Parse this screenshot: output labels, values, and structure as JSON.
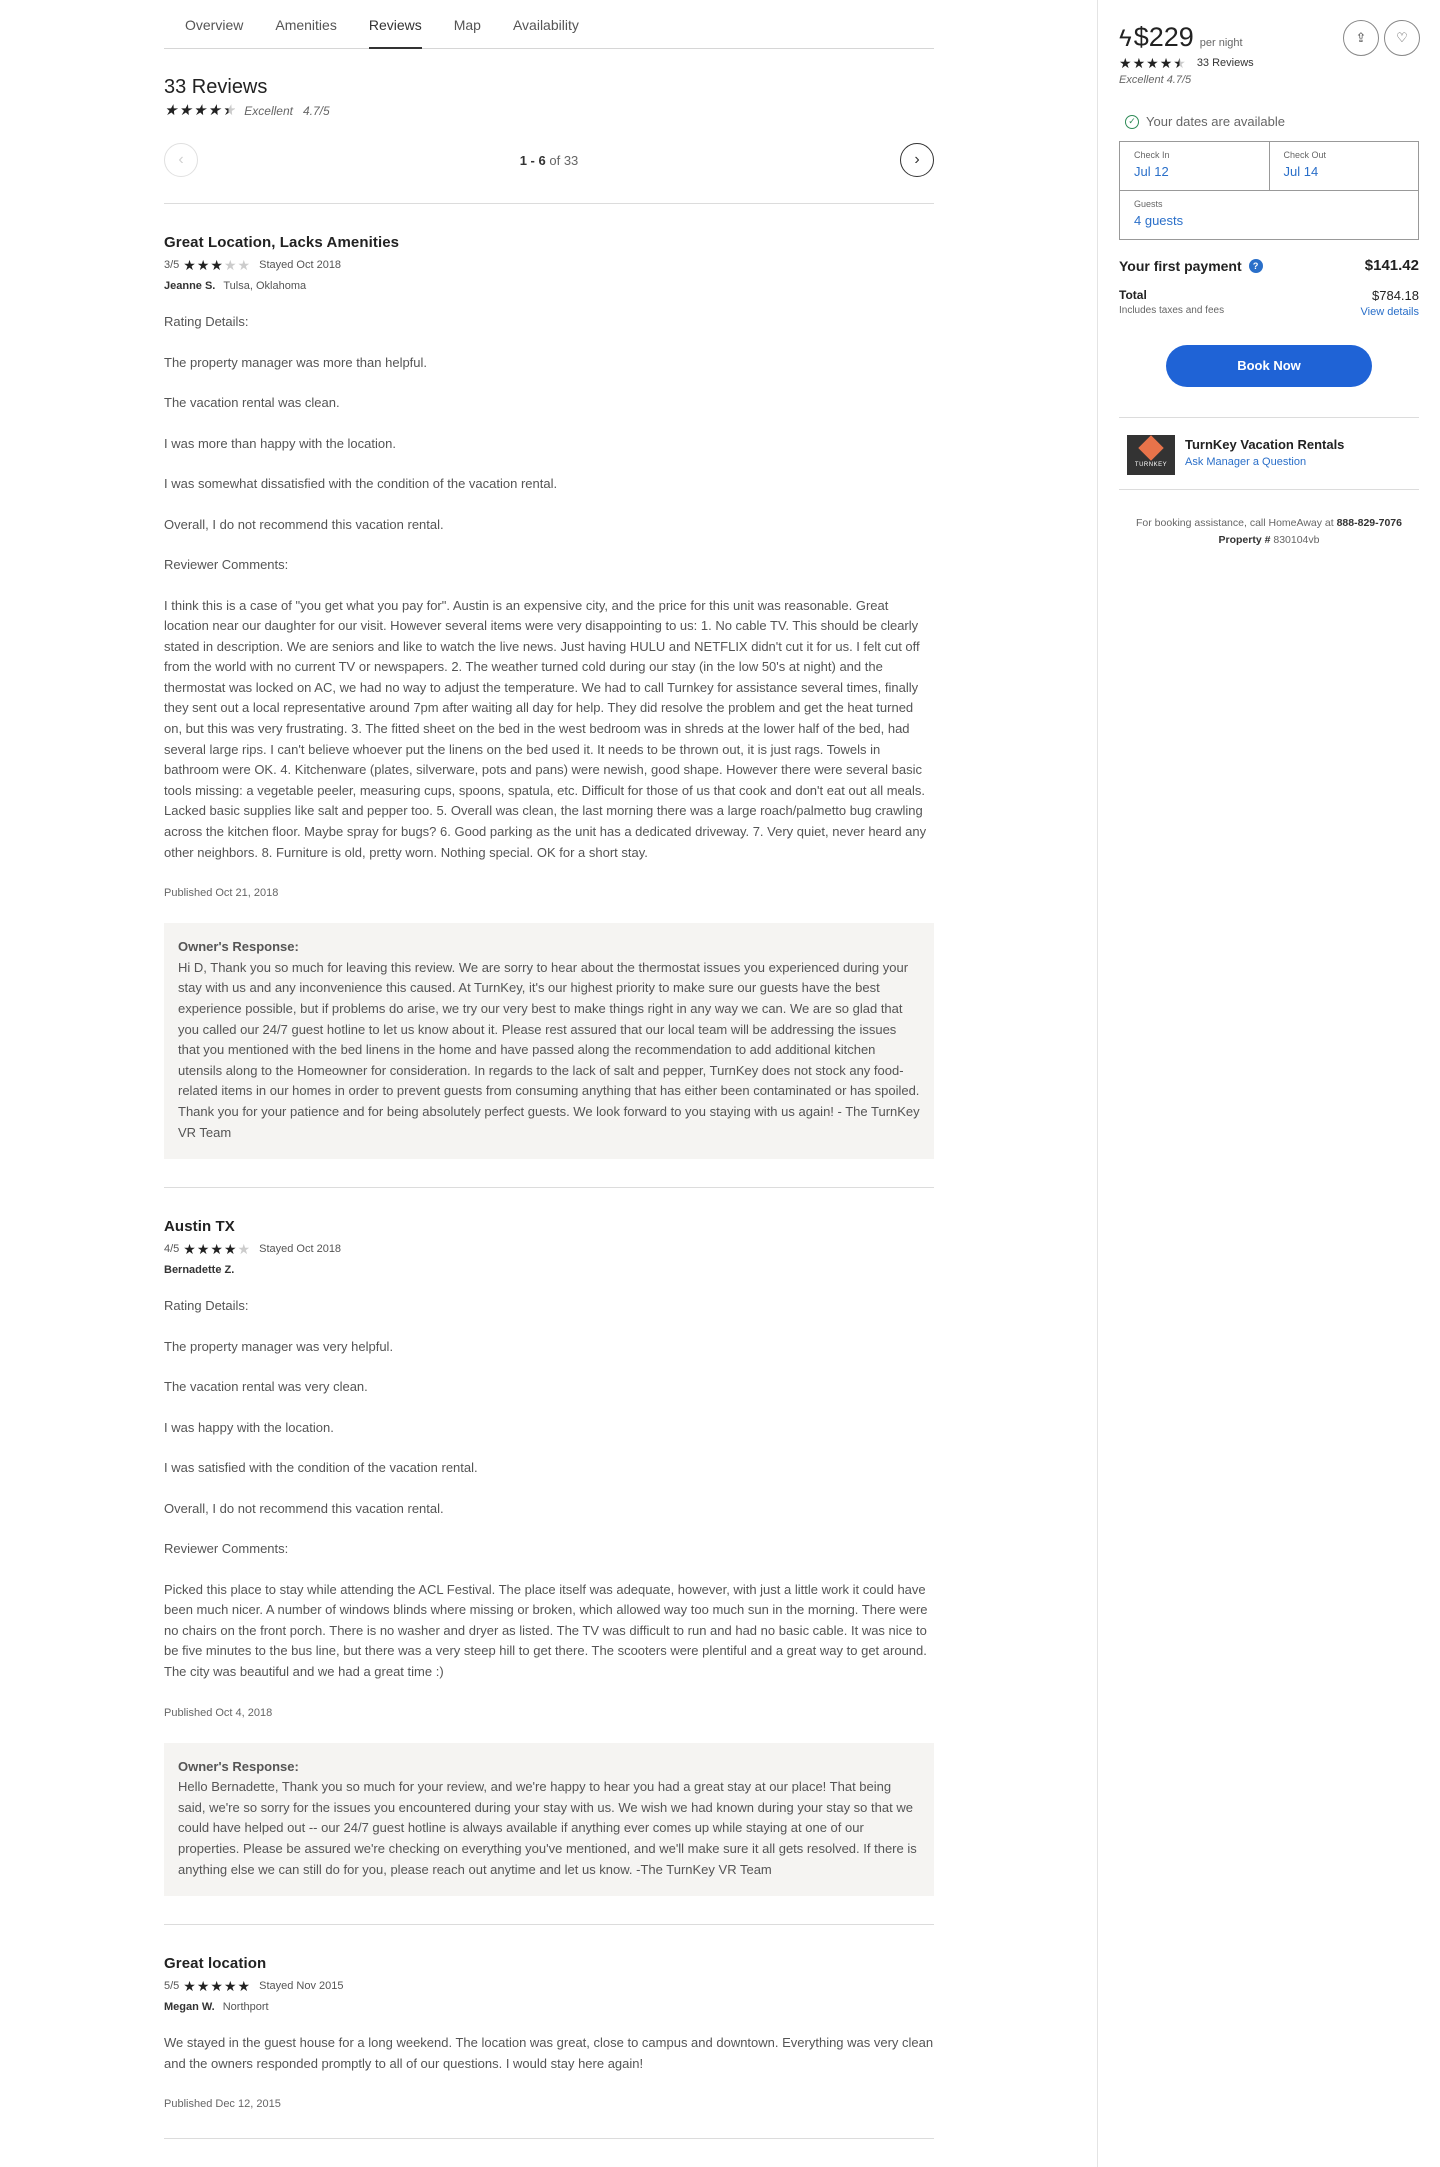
{
  "tabs": [
    "Overview",
    "Amenities",
    "Reviews",
    "Map",
    "Availability"
  ],
  "active_tab": "Reviews",
  "reviews_header": {
    "title": "33 Reviews",
    "rating_label": "Excellent",
    "rating_score": "4.7/5",
    "stars": 4.5
  },
  "pager": {
    "range": "1 - 6",
    "of_total": "of 33",
    "prev_icon": "chevron-left-icon",
    "next_icon": "chevron-right-icon"
  },
  "reviews": [
    {
      "title": "Great Location, Lacks Amenities",
      "rating_text": "3/5",
      "stars": 3,
      "stayed": "Stayed Oct 2018",
      "reviewer": "Jeanne S.",
      "location": "Tulsa, Oklahoma",
      "rating_details_label": "Rating Details:",
      "details": [
        "The property manager was more than helpful.",
        "The vacation rental was clean.",
        "I was more than happy with the location.",
        "I was somewhat dissatisfied with the condition of the vacation rental.",
        "Overall, I do not recommend this vacation rental."
      ],
      "comments_label": "Reviewer Comments:",
      "comment": "I think this is a case of \"you get what you pay for\". Austin is an expensive city, and the price for this unit was reasonable. Great location near our daughter for our visit. However several items were very disappointing to us: 1. No cable TV. This should be clearly stated in description. We are seniors and like to watch the live news. Just having HULU and NETFLIX didn't cut it for us. I felt cut off from the world with no current TV or newspapers. 2. The weather turned cold during our stay (in the low 50's at night) and the thermostat was locked on AC, we had no way to adjust the temperature. We had to call Turnkey for assistance several times, finally they sent out a local representative around 7pm after waiting all day for help. They did resolve the problem and get the heat turned on, but this was very frustrating. 3. The fitted sheet on the bed in the west bedroom was in shreds at the lower half of the bed, had several large rips. I can't believe whoever put the linens on the bed used it. It needs to be thrown out, it is just rags. Towels in bathroom were OK. 4. Kitchenware (plates, silverware, pots and pans) were newish, good shape. However there were several basic tools missing: a vegetable peeler, measuring cups, spoons, spatula, etc. Difficult for those of us that cook and don't eat out all meals. Lacked basic supplies like salt and pepper too. 5. Overall was clean, the last morning there was a large roach/palmetto bug crawling across the kitchen floor. Maybe spray for bugs? 6. Good parking as the unit has a dedicated driveway. 7. Very quiet, never heard any other neighbors. 8. Furniture is old, pretty worn. Nothing special. OK for a short stay.",
      "published": "Published Oct 21, 2018",
      "owner_label": "Owner's Response:",
      "owner_response": "Hi D, Thank you so much for leaving this review. We are sorry to hear about the thermostat issues you experienced during your stay with us and any inconvenience this caused. At TurnKey, it's our highest priority to make sure our guests have the best experience possible, but if problems do arise, we try our very best to make things right in any way we can. We are so glad that you called our 24/7 guest hotline to let us know about it. Please rest assured that our local team will be addressing the issues that you mentioned with the bed linens in the home and have passed along the recommendation to add additional kitchen utensils along to the Homeowner for consideration. In regards to the lack of salt and pepper, TurnKey does not stock any food-related items in our homes in order to prevent guests from consuming anything that has either been contaminated or has spoiled. Thank you for your patience and for being absolutely perfect guests. We look forward to you staying with us again! - The TurnKey VR Team"
    },
    {
      "title": "Austin TX",
      "rating_text": "4/5",
      "stars": 4,
      "stayed": "Stayed Oct 2018",
      "reviewer": "Bernadette Z.",
      "location": "",
      "rating_details_label": "Rating Details:",
      "details": [
        "The property manager was very helpful.",
        "The vacation rental was very clean.",
        "I was happy with the location.",
        "I was satisfied with the condition of the vacation rental.",
        "Overall, I do not recommend this vacation rental."
      ],
      "comments_label": "Reviewer Comments:",
      "comment": "Picked this place to stay while attending the ACL Festival. The place itself was adequate, however, with just a little work it could have been much nicer. A number of windows blinds where missing or broken, which allowed way too much sun in the morning. There were no chairs on the front porch. There is no washer and dryer as listed. The TV was difficult to run and had no basic cable. It was nice to be five minutes to the bus line, but there was a very steep hill to get there. The scooters were plentiful and a great way to get around. The city was beautiful and we had a great time :)",
      "published": "Published Oct 4, 2018",
      "owner_label": "Owner's Response:",
      "owner_response": "Hello Bernadette, Thank you so much for your review, and we're happy to hear you had a great stay at our place! That being said, we're so sorry for the issues you encountered during your stay with us. We wish we had known during your stay so that we could have helped out -- our 24/7 guest hotline is always available if anything ever comes up while staying at one of our properties. Please be assured we're checking on everything you've mentioned, and we'll make sure it all gets resolved. If there is anything else we can still do for you, please reach out anytime and let us know. -The TurnKey VR Team"
    },
    {
      "title": "Great location",
      "rating_text": "5/5",
      "stars": 5,
      "stayed": "Stayed Nov 2015",
      "reviewer": "Megan W.",
      "location": "Northport",
      "comment": "We stayed in the guest house for a long weekend. The location was great, close to campus and downtown. Everything was very clean and the owners responded promptly to all of our questions. I would stay here again!",
      "published": "Published Dec 12, 2015"
    }
  ],
  "sidebar": {
    "price": "$229",
    "per_night": "per night",
    "reviews_count": "33 Reviews",
    "excellent": "Excellent 4.7/5",
    "stars": 4.5,
    "available": "Your dates are available",
    "check_in_label": "Check In",
    "check_in": "Jul 12",
    "check_out_label": "Check Out",
    "check_out": "Jul 14",
    "guests_label": "Guests",
    "guests": "4 guests",
    "first_payment_label": "Your first payment",
    "first_payment": "$141.42",
    "total_label": "Total",
    "total": "$784.18",
    "includes": "Includes taxes and fees",
    "view_details": "View details",
    "book_now": "Book Now",
    "manager_name": "TurnKey Vacation Rentals",
    "ask_manager": "Ask Manager a Question",
    "logo_text": "TURNKEY",
    "assist_text": "For booking assistance, call HomeAway at",
    "assist_phone": "888-829-7076",
    "property_label": "Property #",
    "property_id": "830104vb"
  },
  "colors": {
    "link": "#2a6fc9",
    "book_button": "#1f63d6",
    "owner_bg": "#f5f4f2",
    "available_check": "#2e8b57"
  }
}
